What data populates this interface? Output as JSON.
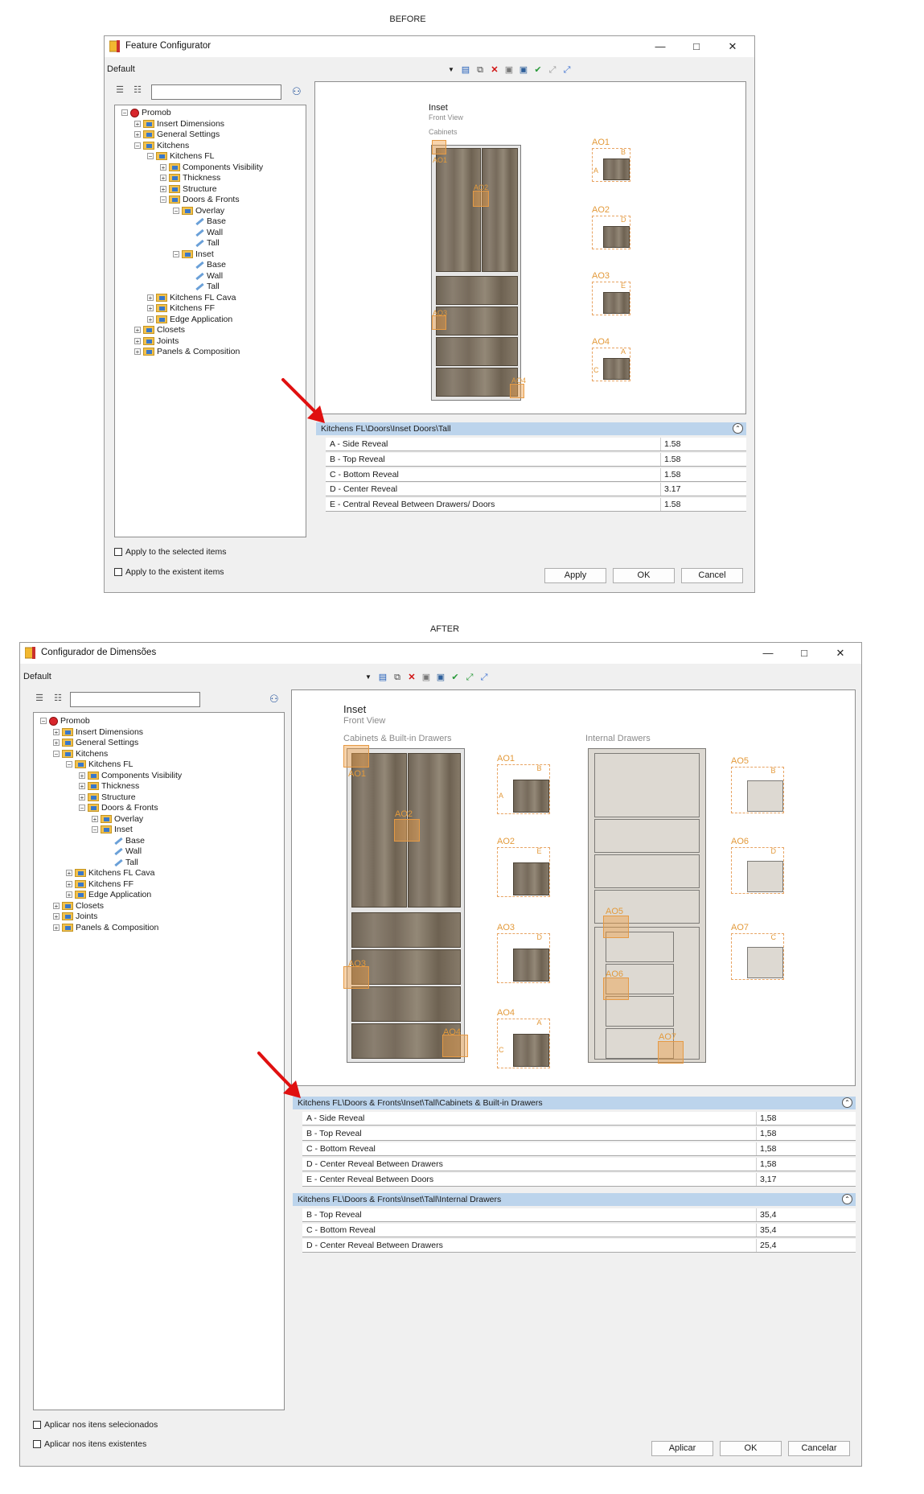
{
  "before": {
    "caption": "BEFORE",
    "window_title": "Feature Configurator",
    "profile": "Default",
    "tree": [
      {
        "label": "Promob",
        "level": 0,
        "exp": "−",
        "icon": "root"
      },
      {
        "label": "Insert Dimensions",
        "level": 1,
        "exp": "+",
        "icon": "folder"
      },
      {
        "label": "General Settings",
        "level": 1,
        "exp": "+",
        "icon": "folder"
      },
      {
        "label": "Kitchens",
        "level": 1,
        "exp": "−",
        "icon": "folder"
      },
      {
        "label": "Kitchens FL",
        "level": 2,
        "exp": "−",
        "icon": "folder"
      },
      {
        "label": "Components Visibility",
        "level": 3,
        "exp": "+",
        "icon": "folder"
      },
      {
        "label": "Thickness",
        "level": 3,
        "exp": "+",
        "icon": "folder"
      },
      {
        "label": "Structure",
        "level": 3,
        "exp": "+",
        "icon": "folder"
      },
      {
        "label": "Doors & Fronts",
        "level": 3,
        "exp": "−",
        "icon": "folder"
      },
      {
        "label": "Overlay",
        "level": 4,
        "exp": "−",
        "icon": "folder"
      },
      {
        "label": "Base",
        "level": 5,
        "exp": "",
        "icon": "leaf"
      },
      {
        "label": "Wall",
        "level": 5,
        "exp": "",
        "icon": "leaf"
      },
      {
        "label": "Tall",
        "level": 5,
        "exp": "",
        "icon": "leaf"
      },
      {
        "label": "Inset",
        "level": 4,
        "exp": "−",
        "icon": "folder"
      },
      {
        "label": "Base",
        "level": 5,
        "exp": "",
        "icon": "leaf"
      },
      {
        "label": "Wall",
        "level": 5,
        "exp": "",
        "icon": "leaf"
      },
      {
        "label": "Tall",
        "level": 5,
        "exp": "",
        "icon": "leaf"
      },
      {
        "label": "Kitchens FL Cava",
        "level": 2,
        "exp": "+",
        "icon": "folder"
      },
      {
        "label": "Kitchens FF",
        "level": 2,
        "exp": "+",
        "icon": "folder"
      },
      {
        "label": "Edge Application",
        "level": 2,
        "exp": "+",
        "icon": "folder"
      },
      {
        "label": "Closets",
        "level": 1,
        "exp": "+",
        "icon": "folder"
      },
      {
        "label": "Joints",
        "level": 1,
        "exp": "+",
        "icon": "folder"
      },
      {
        "label": "Panels & Composition",
        "level": 1,
        "exp": "+",
        "icon": "folder"
      }
    ],
    "preview": {
      "title": "Inset",
      "subtitle": "Front View",
      "section": "Cabinets",
      "markers": [
        "AO1",
        "AO2",
        "AO3",
        "AO4"
      ],
      "details": [
        "AO1",
        "AO2",
        "AO3",
        "AO4"
      ],
      "letters": {
        "b": "B",
        "a": "A",
        "d": "D",
        "e": "E",
        "c": "C"
      }
    },
    "groups": [
      {
        "title": "Kitchens FL\\Doors\\Inset Doors\\Tall",
        "rows": [
          {
            "label": "A - Side Reveal",
            "value": "1.58"
          },
          {
            "label": "B - Top Reveal",
            "value": "1.58"
          },
          {
            "label": "C - Bottom Reveal",
            "value": "1.58"
          },
          {
            "label": "D - Center Reveal",
            "value": "3.17"
          },
          {
            "label": "E - Central Reveal Between Drawers/ Doors",
            "value": "1.58"
          }
        ]
      }
    ],
    "checkboxes": [
      "Apply to the selected items",
      "Apply to the existent items"
    ],
    "buttons": {
      "apply": "Apply",
      "ok": "OK",
      "cancel": "Cancel"
    }
  },
  "after": {
    "caption": "AFTER",
    "window_title": "Configurador de Dimensões",
    "profile": "Default",
    "tree": [
      {
        "label": "Promob",
        "level": 0,
        "exp": "−",
        "icon": "root"
      },
      {
        "label": "Insert Dimensions",
        "level": 1,
        "exp": "+",
        "icon": "folder"
      },
      {
        "label": "General Settings",
        "level": 1,
        "exp": "+",
        "icon": "folder"
      },
      {
        "label": "Kitchens",
        "level": 1,
        "exp": "−",
        "icon": "folder"
      },
      {
        "label": "Kitchens FL",
        "level": 2,
        "exp": "−",
        "icon": "folder"
      },
      {
        "label": "Components Visibility",
        "level": 3,
        "exp": "+",
        "icon": "folder"
      },
      {
        "label": "Thickness",
        "level": 3,
        "exp": "+",
        "icon": "folder"
      },
      {
        "label": "Structure",
        "level": 3,
        "exp": "+",
        "icon": "folder"
      },
      {
        "label": "Doors & Fronts",
        "level": 3,
        "exp": "−",
        "icon": "folder"
      },
      {
        "label": "Overlay",
        "level": 4,
        "exp": "+",
        "icon": "folder"
      },
      {
        "label": "Inset",
        "level": 4,
        "exp": "−",
        "icon": "folder"
      },
      {
        "label": "Base",
        "level": 5,
        "exp": "",
        "icon": "leaf"
      },
      {
        "label": "Wall",
        "level": 5,
        "exp": "",
        "icon": "leaf"
      },
      {
        "label": "Tall",
        "level": 5,
        "exp": "",
        "icon": "leaf"
      },
      {
        "label": "Kitchens FL Cava",
        "level": 2,
        "exp": "+",
        "icon": "folder"
      },
      {
        "label": "Kitchens FF",
        "level": 2,
        "exp": "+",
        "icon": "folder"
      },
      {
        "label": "Edge Application",
        "level": 2,
        "exp": "+",
        "icon": "folder"
      },
      {
        "label": "Closets",
        "level": 1,
        "exp": "+",
        "icon": "folder"
      },
      {
        "label": "Joints",
        "level": 1,
        "exp": "+",
        "icon": "folder"
      },
      {
        "label": "Panels & Composition",
        "level": 1,
        "exp": "+",
        "icon": "folder"
      }
    ],
    "preview": {
      "title": "Inset",
      "subtitle": "Front View",
      "section_left": "Cabinets & Built-in Drawers",
      "section_right": "Internal Drawers",
      "left_markers": [
        "AO1",
        "AO2",
        "AO3",
        "AO4"
      ],
      "right_markers": [
        "AO5",
        "AO6",
        "AO7"
      ],
      "left_details": [
        "AO1",
        "AO2",
        "AO3",
        "AO4"
      ],
      "right_details": [
        "AO5",
        "AO6",
        "AO7"
      ],
      "letters": {
        "b": "B",
        "a": "A",
        "e": "E",
        "d": "D",
        "c": "C"
      }
    },
    "groups": [
      {
        "title": "Kitchens FL\\Doors & Fronts\\Inset\\Tall\\Cabinets & Built-in Drawers",
        "rows": [
          {
            "label": "A - Side Reveal",
            "value": "1,58"
          },
          {
            "label": "B - Top Reveal",
            "value": "1,58"
          },
          {
            "label": "C - Bottom Reveal",
            "value": "1,58"
          },
          {
            "label": "D - Center Reveal Between Drawers",
            "value": "1,58"
          },
          {
            "label": "E - Center Reveal Between Doors",
            "value": "3,17"
          }
        ]
      },
      {
        "title": "Kitchens FL\\Doors & Fronts\\Inset\\Tall\\Internal Drawers",
        "rows": [
          {
            "label": "B - Top Reveal",
            "value": "35,4"
          },
          {
            "label": "C - Bottom Reveal",
            "value": "35,4"
          },
          {
            "label": "D - Center Reveal Between Drawers",
            "value": "25,4"
          }
        ]
      }
    ],
    "checkboxes": [
      "Aplicar nos itens selecionados",
      "Aplicar nos itens existentes"
    ],
    "buttons": {
      "apply": "Aplicar",
      "ok": "OK",
      "cancel": "Cancelar"
    }
  },
  "icons": [
    "app-icon",
    "minimize-icon",
    "maximize-icon",
    "close-icon",
    "dropdown-icon",
    "new-profile-icon",
    "copy-profile-icon",
    "delete-icon",
    "save-icon",
    "save-all-icon",
    "validate-icon",
    "expand-icon",
    "collapse-icon",
    "tree-view-icon",
    "list-view-icon",
    "binoculars-icon",
    "red-arrow-icon"
  ],
  "colors": {
    "group_header": "#bcd4ec",
    "hotspot": "#f0a046",
    "arrow": "#e01010"
  }
}
